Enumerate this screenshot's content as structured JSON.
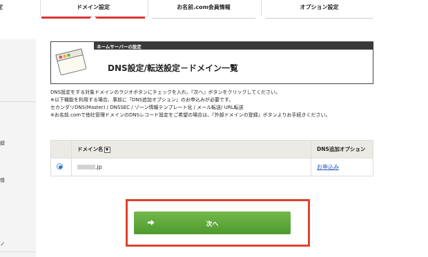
{
  "nav": {
    "first_partial": "定",
    "tabs": [
      "ドメイン設定",
      "お名前.com会員情報",
      "オプション設定"
    ]
  },
  "sidebar": {
    "items": [
      "録",
      "情",
      "ノ"
    ]
  },
  "header": {
    "bar_label": "ネームサーバーの設定",
    "title": "DNS設定/転送設定－ドメイン一覧"
  },
  "description": [
    "DNS設定をする対象ドメインのラジオボタンにチェックを入れ、『次へ』ボタンをクリックしてください。",
    "※以下機能を利用する場合、事前に『DNS追加オプション』のお申込みが必要です。",
    "セカンダリDNS(Master) / DNSSEC / ゾーン情報テンプレート化 / メール転送/ URL転送",
    "※お名前.comで他社管理ドメインのDNSレコード設定をご希望の場合は、『外部ドメインの登録』ボタンよりお手続きください。"
  ],
  "table": {
    "headers": [
      "",
      "ドメイン名",
      "DNS追加オプション"
    ],
    "rows": [
      {
        "domain_suffix": ".jp",
        "option_link": "お申込み",
        "selected": true
      }
    ]
  },
  "next_button": {
    "label": "次へ"
  },
  "colors": {
    "accent_red": "#e0412b",
    "button_green": "#5ea63a",
    "header_dark": "#3a3a3a"
  }
}
